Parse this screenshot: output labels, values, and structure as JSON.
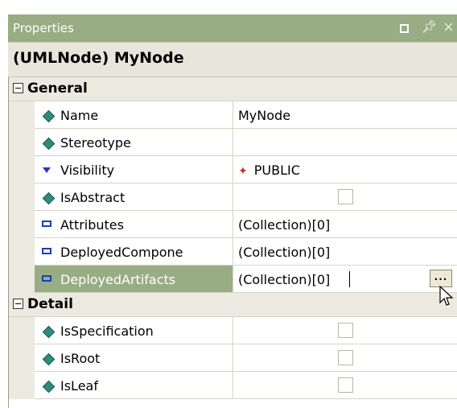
{
  "window": {
    "title": "Properties",
    "controls": [
      "restore",
      "pin",
      "close"
    ]
  },
  "object_header": "(UMLNode) MyNode",
  "categories": [
    {
      "label": "General",
      "rows": [
        {
          "name": "Name",
          "icon": "diamond",
          "value": "MyNode"
        },
        {
          "name": "Stereotype",
          "icon": "diamond",
          "value": ""
        },
        {
          "name": "Visibility",
          "icon": "tri-down",
          "value": "PUBLIC",
          "value_icon": "public-visibility-icon"
        },
        {
          "name": "IsAbstract",
          "icon": "diamond",
          "value_checkbox": false
        },
        {
          "name": "Attributes",
          "icon": "collection",
          "value": "(Collection)[0]"
        },
        {
          "name": "DeployedCompone",
          "icon": "collection",
          "value": "(Collection)[0]"
        },
        {
          "name": "DeployedArtifacts",
          "icon": "collection",
          "value": "(Collection)[0]",
          "selected": true,
          "ellipsis": "..."
        }
      ]
    },
    {
      "label": "Detail",
      "rows": [
        {
          "name": "IsSpecification",
          "icon": "diamond",
          "value_checkbox": false
        },
        {
          "name": "IsRoot",
          "icon": "diamond",
          "value_checkbox": false
        },
        {
          "name": "IsLeaf",
          "icon": "diamond",
          "value_checkbox": false
        }
      ]
    }
  ],
  "colors": {
    "title_bar": "#98ad83",
    "selection": "#98ad83",
    "category_bg": "#eceae0",
    "diamond_icon": "#2e8b7a",
    "collection_icon": "#1a3fb8"
  }
}
